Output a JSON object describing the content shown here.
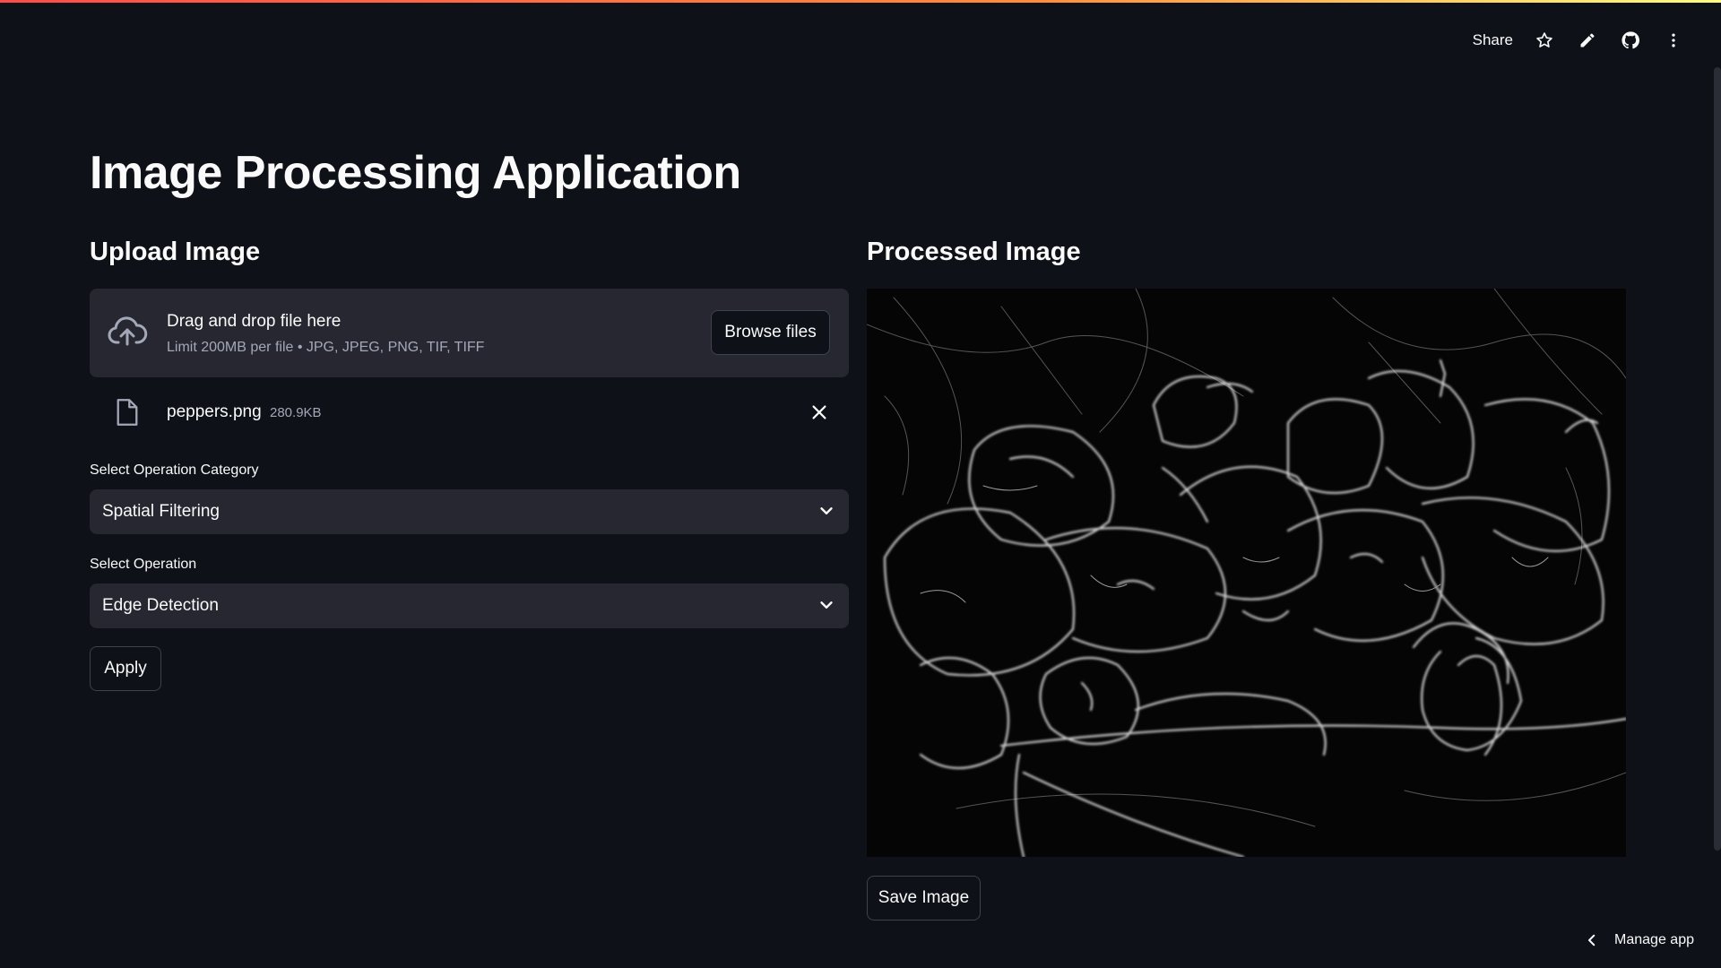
{
  "header": {
    "share_label": "Share",
    "icons": [
      "star-icon",
      "pencil-icon",
      "github-icon",
      "more-vertical-icon"
    ]
  },
  "page": {
    "title": "Image Processing Application"
  },
  "upload": {
    "section_title": "Upload Image",
    "dropzone_title": "Drag and drop file here",
    "dropzone_subtitle": "Limit 200MB per file • JPG, JPEG, PNG, TIF, TIFF",
    "browse_label": "Browse files",
    "file": {
      "name": "peppers.png",
      "size": "280.9KB"
    }
  },
  "controls": {
    "category_label": "Select Operation Category",
    "category_value": "Spatial Filtering",
    "operation_label": "Select Operation",
    "operation_value": "Edge Detection",
    "apply_label": "Apply"
  },
  "output": {
    "section_title": "Processed Image",
    "save_label": "Save Image"
  },
  "footer": {
    "manage_label": "Manage app"
  },
  "colors": {
    "background": "#0e1117",
    "surface": "#262730",
    "accent_gradient_start": "#ff4b4b",
    "accent_gradient_end": "#fffd80",
    "muted_text": "#a3a8b8"
  }
}
